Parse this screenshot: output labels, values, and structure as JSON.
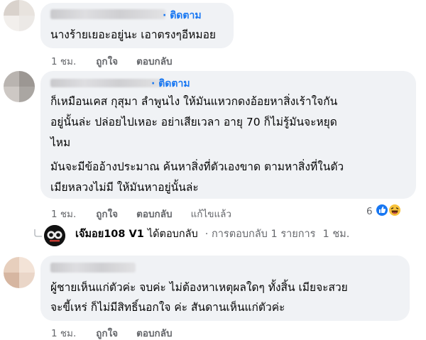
{
  "comments": [
    {
      "follow": "· ติดตาม",
      "lines": [
        "นางร้ายเยอะอยู่นะ เอาตรงๆอีหมอย"
      ],
      "time": "1 ชม.",
      "like": "ถูกใจ",
      "reply": "ตอบกลับ"
    },
    {
      "follow": "· ติดตาม",
      "lines": [
        "ก็เหมือนเคส กุสุมา ลำพูนไง ให้มันแหวกดงอ้อยหาสิ่งเร้าใจกัน",
        "อยู่นั้นล่ะ ปล่อยไปเหอะ อย่าเสียเวลา อายุ 70 ก็ไม่รู้มันจะหยุด",
        "ไหม",
        "มันจะมีข้ออ้างประมาณ ค้นหาสิ่งที่ตัวเองขาด ตามหาสิ่งที่ในตัว",
        "เมียหลวงไม่มี ให้มันหาอยู่นั้นล่ะ"
      ],
      "time": "1 ชม.",
      "like": "ถูกใจ",
      "reply": "ตอบกลับ",
      "edited": "แก้ไขแล้ว",
      "reaction_count": "6",
      "reply_summary": {
        "name": "เจ๊มอย108 V1",
        "text": "ได้ตอบกลับ",
        "meta": "· การตอบกลับ 1 รายการ",
        "time": "1 ชม."
      }
    },
    {
      "lines": [
        "ผู้ชายเห็นแก่ตัวค่ะ จบค่ะ ไม่ต้องหาเหตุผลใดๆ ทั้งสิ้น เมียจะสวย",
        "จะขี้เหร่ ก็ไม่มีสิทธิ์นอกใจ ค่ะ สันดานเห็นแก่ตัวค่ะ"
      ],
      "time": "1 ชม.",
      "like": "ถูกใจ",
      "reply": "ตอบกลับ"
    }
  ],
  "colors": {
    "bubble": "#f0f2f5",
    "link": "#1877f2",
    "meta": "#65676b"
  },
  "icons": {
    "like": "thumbs-up-icon",
    "haha": "haha-emoji-icon",
    "reply_arrow": "reply-arrow-icon"
  }
}
